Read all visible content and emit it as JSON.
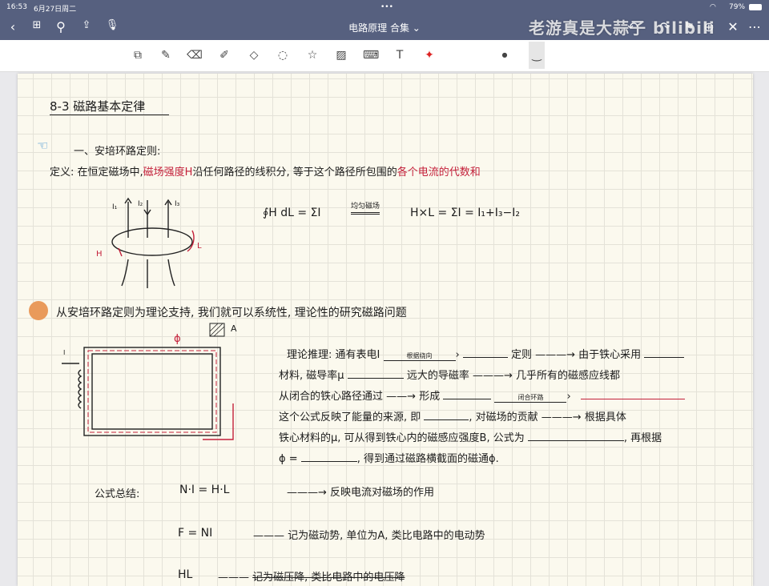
{
  "status": {
    "time": "16:53",
    "date": "6月27日周二",
    "battery": "79%"
  },
  "nav": {
    "title": "电路原理 合集",
    "watermark": "老游真是大蒜子 bilibili"
  },
  "toolbar": [
    "zoom-window",
    "pen",
    "eraser",
    "highlighter",
    "shapes",
    "lasso",
    "elements",
    "image",
    "keyboard",
    "text",
    "laser-pointer"
  ],
  "note": {
    "heading": "8-3  磁路基本定律",
    "section1": "一、安培环路定则:",
    "def_a": "定义: 在恒定磁场中,",
    "def_b": "磁场强度H",
    "def_c": "沿任何路径的线积分, 等于这个路径所包围的",
    "def_d": "各个电流的代数和",
    "currents": [
      "I₁",
      "I₂",
      "I₃"
    ],
    "H_label": "H",
    "L_label": "L",
    "eq_left": "∮H dL = ΣI",
    "eq_arrow": "均匀磁场",
    "eq_right": "H×L = ΣI = I₁+I₃−I₂",
    "section2": "从安培环路定则为理论支持, 我们就可以系统性, 理论性的研究磁路问题",
    "phi": "ϕ",
    "A": "A",
    "I": "I",
    "l1a": "理论推理: 通有表电I",
    "l1arrow": "根据绕向",
    "l1b": "定则",
    "l1c": "由于铁心采用",
    "l2a": "材料, 磁导率μ",
    "l2b": "远大的导磁率",
    "l2c": "几乎所有的磁感应线都",
    "l3a": "从闭合的铁心路径通过",
    "l3b": "形成",
    "l3arrow": "闭合环路",
    "l4a": "这个公式反映了能量的来源, 即",
    "l4b": ", 对磁场的贡献",
    "l4c": "根据具体",
    "l5a": "铁心材料的μ, 可从得到铁心内的磁感应强度B, 公式为",
    "l5b": ", 再根据",
    "l6a": "ϕ =",
    "l6b": ", 得到通过磁路横截面的磁通ϕ.",
    "sum_label": "公式总结:",
    "f1": "N·I = H·L",
    "f1d": "反映电流对磁场的作用",
    "f2": "F = NI",
    "f2d": "记为磁动势, 单位为A, 类比电路中的电动势",
    "f3": "HL",
    "f3d": "记为磁压降, 类比电路中的电压降"
  }
}
